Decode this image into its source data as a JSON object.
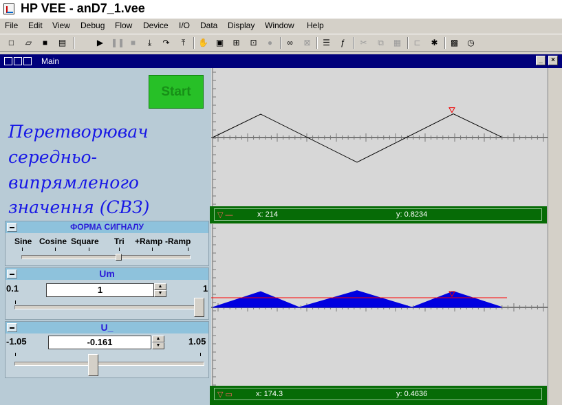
{
  "window": {
    "title": "HP VEE - anD7_1.vee"
  },
  "menu": [
    "File",
    "Edit",
    "View",
    "Debug",
    "Flow",
    "Device",
    "I/O",
    "Data",
    "Display",
    "Window",
    "Help"
  ],
  "toolbar_icons": [
    "new-icon",
    "open-icon",
    "save-icon",
    "print-icon",
    "run-icon",
    "pause-icon",
    "stop-icon",
    "step-into-icon",
    "step-over-icon",
    "step-out-icon",
    "hand-icon",
    "object-icon",
    "data-flow-icon",
    "line-probe-icon",
    "activity-icon",
    "find-icon",
    "binoculars-icon",
    "properties-icon",
    "function-icon",
    "cut-icon",
    "copy-icon",
    "paste-icon",
    "align-icon",
    "tree-icon",
    "panel-icon",
    "timer-icon"
  ],
  "mdi": {
    "title": "Main",
    "min": "_",
    "close": "×"
  },
  "start_button": {
    "label": "Start"
  },
  "heading_lines": [
    "Перетворювач",
    "середньо-",
    "випрямленого",
    "значення (СВЗ)"
  ],
  "form_control": {
    "title": "ФОРМА СИГНАЛУ",
    "options": [
      "Sine",
      "Cosine",
      "Square",
      "Tri",
      "+Ramp",
      "-Ramp"
    ],
    "selected": "Tri"
  },
  "um_control": {
    "title": "Um",
    "min": "0.1",
    "max": "1",
    "value": "1"
  },
  "u0_control": {
    "title": "U_",
    "min": "-1.05",
    "max": "1.05",
    "value": "-0.161"
  },
  "plot_top": {
    "marker": {
      "x_label": "x: 214",
      "y_label": "y: 0.8234"
    },
    "chart_data": {
      "type": "line",
      "points": [
        [
          0,
          0
        ],
        [
          35,
          0.85
        ],
        [
          105,
          -0.9
        ],
        [
          175,
          0.86
        ],
        [
          210,
          0.02
        ]
      ],
      "xlim": [
        0,
        214
      ],
      "ylim": [
        -2,
        2
      ]
    }
  },
  "plot_bottom": {
    "marker": {
      "x_label": "x: 174.3",
      "y_label": "y: 0.4636"
    },
    "chart_data": {
      "type": "area",
      "points": [
        [
          0,
          0
        ],
        [
          35,
          0.85
        ],
        [
          63,
          0
        ],
        [
          105,
          0.9
        ],
        [
          145,
          0
        ],
        [
          175,
          0.86
        ],
        [
          210,
          0.02
        ]
      ],
      "mean_line": 0.52,
      "xlim": [
        0,
        214
      ],
      "ylim": [
        -2,
        2
      ]
    }
  },
  "colors": {
    "accent": "#1717e6",
    "start": "#27c027",
    "legend": "#066b06",
    "fill": "#0000e0",
    "mean": "#ff0000"
  }
}
